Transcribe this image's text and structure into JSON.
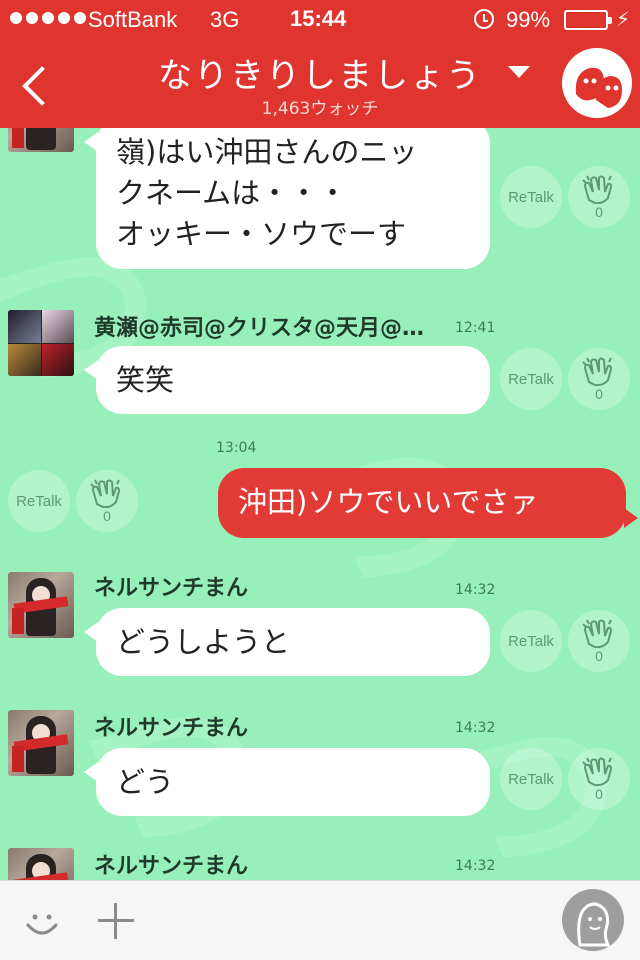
{
  "status_bar": {
    "carrier": "SoftBank",
    "network": "3G",
    "time": "15:44",
    "battery_percent": "99%",
    "alarm_icon": "alarm-icon",
    "battery_icon": "battery-icon",
    "charging_icon": "charging-bolt-icon"
  },
  "header": {
    "title": "なりきりしましょう",
    "watch_count": "1,463ウォッチ",
    "back_icon": "back-chevron-icon",
    "dropdown_icon": "caret-down-icon",
    "avatar_icon": "group-avatar-icon"
  },
  "messages": [
    {
      "id": "m1",
      "direction": "incoming",
      "text_lines": [
        "嶺)はい沖田さんのニッ",
        "クネームは・・・",
        "オッキー・ソウでーす"
      ],
      "retalk_label": "ReTalk",
      "clap_count": "0"
    },
    {
      "id": "m2",
      "direction": "incoming",
      "sender": "黄瀬@赤司@クリスタ@天月@…",
      "time": "12:41",
      "text": "笑笑",
      "retalk_label": "ReTalk",
      "clap_count": "0"
    },
    {
      "id": "m3",
      "direction": "outgoing",
      "time": "13:04",
      "text": "沖田)ソウでいいでさァ",
      "retalk_label": "ReTalk",
      "clap_count": "0"
    },
    {
      "id": "m4",
      "direction": "incoming",
      "sender": "ネルサンチまん",
      "time": "14:32",
      "text": "どうしようと",
      "retalk_label": "ReTalk",
      "clap_count": "0"
    },
    {
      "id": "m5",
      "direction": "incoming",
      "sender": "ネルサンチまん",
      "time": "14:32",
      "text": "どう",
      "retalk_label": "ReTalk",
      "clap_count": "0"
    },
    {
      "id": "m6",
      "direction": "incoming",
      "sender": "ネルサンチまん",
      "time": "14:32"
    }
  ],
  "bottom_bar": {
    "emoji_icon": "smiley-icon",
    "add_icon": "plus-icon",
    "mascot_icon": "mascot-icon"
  },
  "colors": {
    "accent_red": "#e0342f",
    "chat_background": "#97f0b9",
    "outgoing_bubble": "#e23a35",
    "incoming_bubble": "#ffffff"
  }
}
